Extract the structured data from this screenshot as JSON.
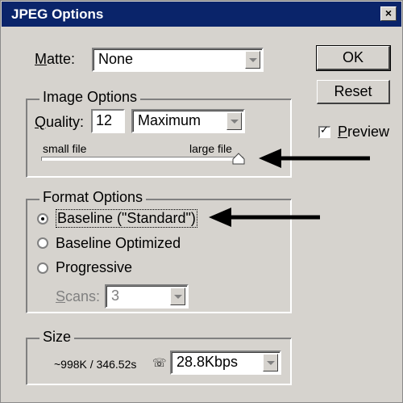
{
  "window": {
    "title": "JPEG Options",
    "close_label": "×"
  },
  "matte": {
    "label": "Matte:",
    "value": "None"
  },
  "buttons": {
    "ok": "OK",
    "reset": "Reset"
  },
  "preview": {
    "label": "Preview",
    "checked": true
  },
  "image_options": {
    "title": "Image Options",
    "quality_label": "Quality:",
    "quality_value": "12",
    "quality_preset": "Maximum",
    "small_label": "small file",
    "large_label": "large file",
    "slider_fraction": 1.0
  },
  "format_options": {
    "title": "Format Options",
    "options": [
      "Baseline (\"Standard\")",
      "Baseline Optimized",
      "Progressive"
    ],
    "selected_index": 0,
    "scans_label": "Scans:",
    "scans_value": "3"
  },
  "size": {
    "title": "Size",
    "estimate": "~998K / 346.52s",
    "speed": "28.8Kbps"
  }
}
